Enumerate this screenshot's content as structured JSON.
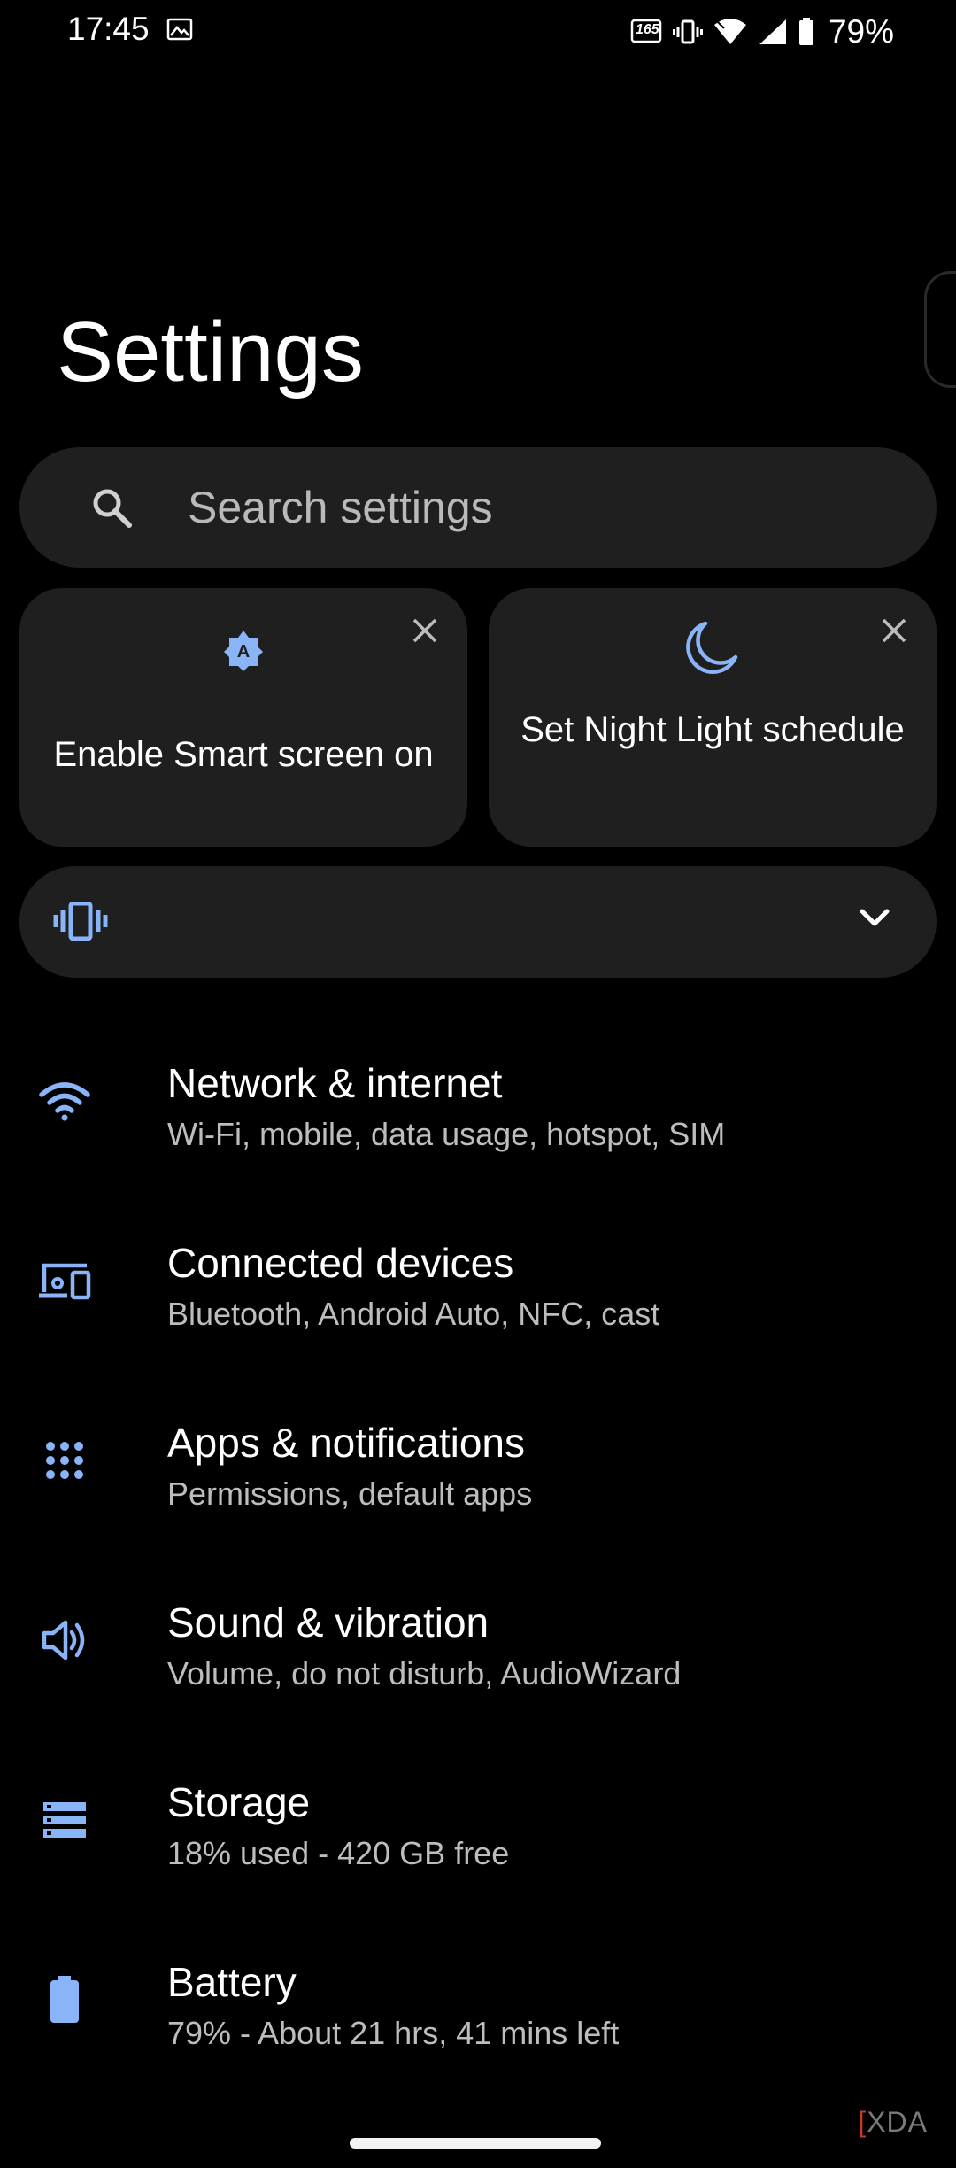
{
  "status_bar": {
    "time": "17:45",
    "battery_percent": "79%",
    "refresh_rate_badge": "165",
    "icons": [
      "gallery-icon",
      "refresh-rate-icon",
      "vibrate-icon",
      "wifi-icon",
      "signal-icon",
      "battery-icon"
    ]
  },
  "page": {
    "title": "Settings"
  },
  "search": {
    "placeholder": "Search settings",
    "value": ""
  },
  "suggestions": [
    {
      "label": "Enable Smart screen on",
      "icon": "smart-screen-icon"
    },
    {
      "label": "Set Night Light schedule",
      "icon": "moon-icon"
    }
  ],
  "quick_bar": {
    "icon": "vibrate-icon",
    "expand_icon": "chevron-down-icon"
  },
  "settings_items": [
    {
      "title": "Network & internet",
      "subtitle": "Wi-Fi, mobile, data usage, hotspot, SIM",
      "icon": "wifi-icon"
    },
    {
      "title": "Connected devices",
      "subtitle": "Bluetooth, Android Auto, NFC, cast",
      "icon": "devices-icon"
    },
    {
      "title": "Apps & notifications",
      "subtitle": "Permissions, default apps",
      "icon": "apps-grid-icon"
    },
    {
      "title": "Sound & vibration",
      "subtitle": "Volume, do not disturb, AudioWizard",
      "icon": "speaker-icon"
    },
    {
      "title": "Storage",
      "subtitle": "18% used - 420 GB free",
      "icon": "storage-icon"
    },
    {
      "title": "Battery",
      "subtitle": "79% - About 21 hrs, 41 mins left",
      "icon": "battery-icon"
    }
  ],
  "watermark": {
    "text": "XDA"
  },
  "colors": {
    "accent": "#8ab4f8",
    "card_background": "#1f1f1f",
    "background": "#000000"
  }
}
